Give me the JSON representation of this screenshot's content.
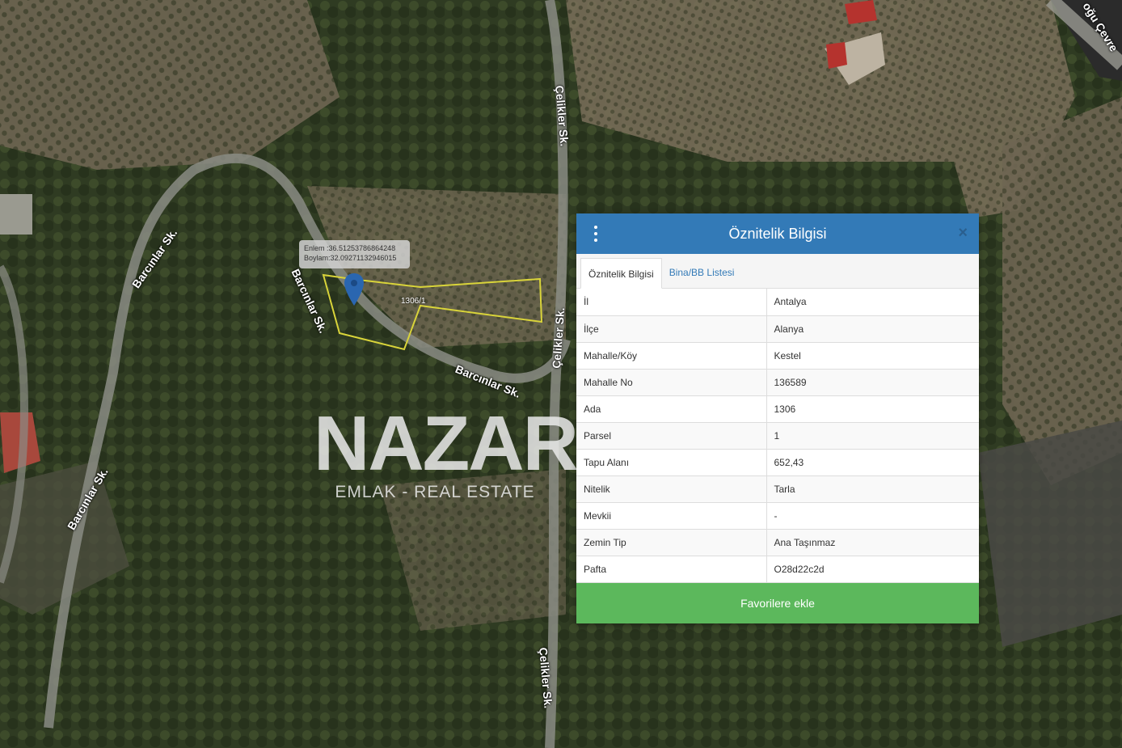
{
  "map": {
    "road_labels": [
      "Barcınlar Sk.",
      "Barcınlar Sk.",
      "Barcınlar Sk.",
      "Barcınlar Sk.",
      "Çelikler Sk.",
      "Çelikler Sk.",
      "Çelikler Sk.",
      "oğu Çevre"
    ],
    "coordinate_tooltip": {
      "lat_line": "Enlem :36.51253786864248",
      "lon_line": "Boylam:32.09271132946015"
    },
    "parcel_label": "1306/1",
    "marker_icon": "map-pin-icon"
  },
  "watermark": {
    "logo": "NAZAR",
    "subtitle": "EMLAK - REAL ESTATE"
  },
  "panel": {
    "title": "Öznitelik Bilgisi",
    "menu_icon": "vertical-dots-icon",
    "close_icon": "close-icon",
    "close_label": "×",
    "tabs": [
      {
        "label": "Öznitelik Bilgisi",
        "active": true
      },
      {
        "label": "Bina/BB Listesi",
        "active": false
      }
    ],
    "rows": [
      {
        "key": "İl",
        "value": "Antalya"
      },
      {
        "key": "İlçe",
        "value": "Alanya"
      },
      {
        "key": "Mahalle/Köy",
        "value": "Kestel"
      },
      {
        "key": "Mahalle No",
        "value": "136589"
      },
      {
        "key": "Ada",
        "value": "1306"
      },
      {
        "key": "Parsel",
        "value": "1"
      },
      {
        "key": "Tapu Alanı",
        "value": "652,43"
      },
      {
        "key": "Nitelik",
        "value": "Tarla"
      },
      {
        "key": "Mevkii",
        "value": "-"
      },
      {
        "key": "Zemin Tip",
        "value": "Ana Taşınmaz"
      },
      {
        "key": "Pafta",
        "value": "O28d22c2d"
      }
    ],
    "favorite_button": "Favorilere ekle"
  },
  "colors": {
    "header": "#337ab7",
    "favorite_button": "#5cb85c",
    "parcel_outline": "#d9d43a",
    "marker": "#2a66b0"
  }
}
